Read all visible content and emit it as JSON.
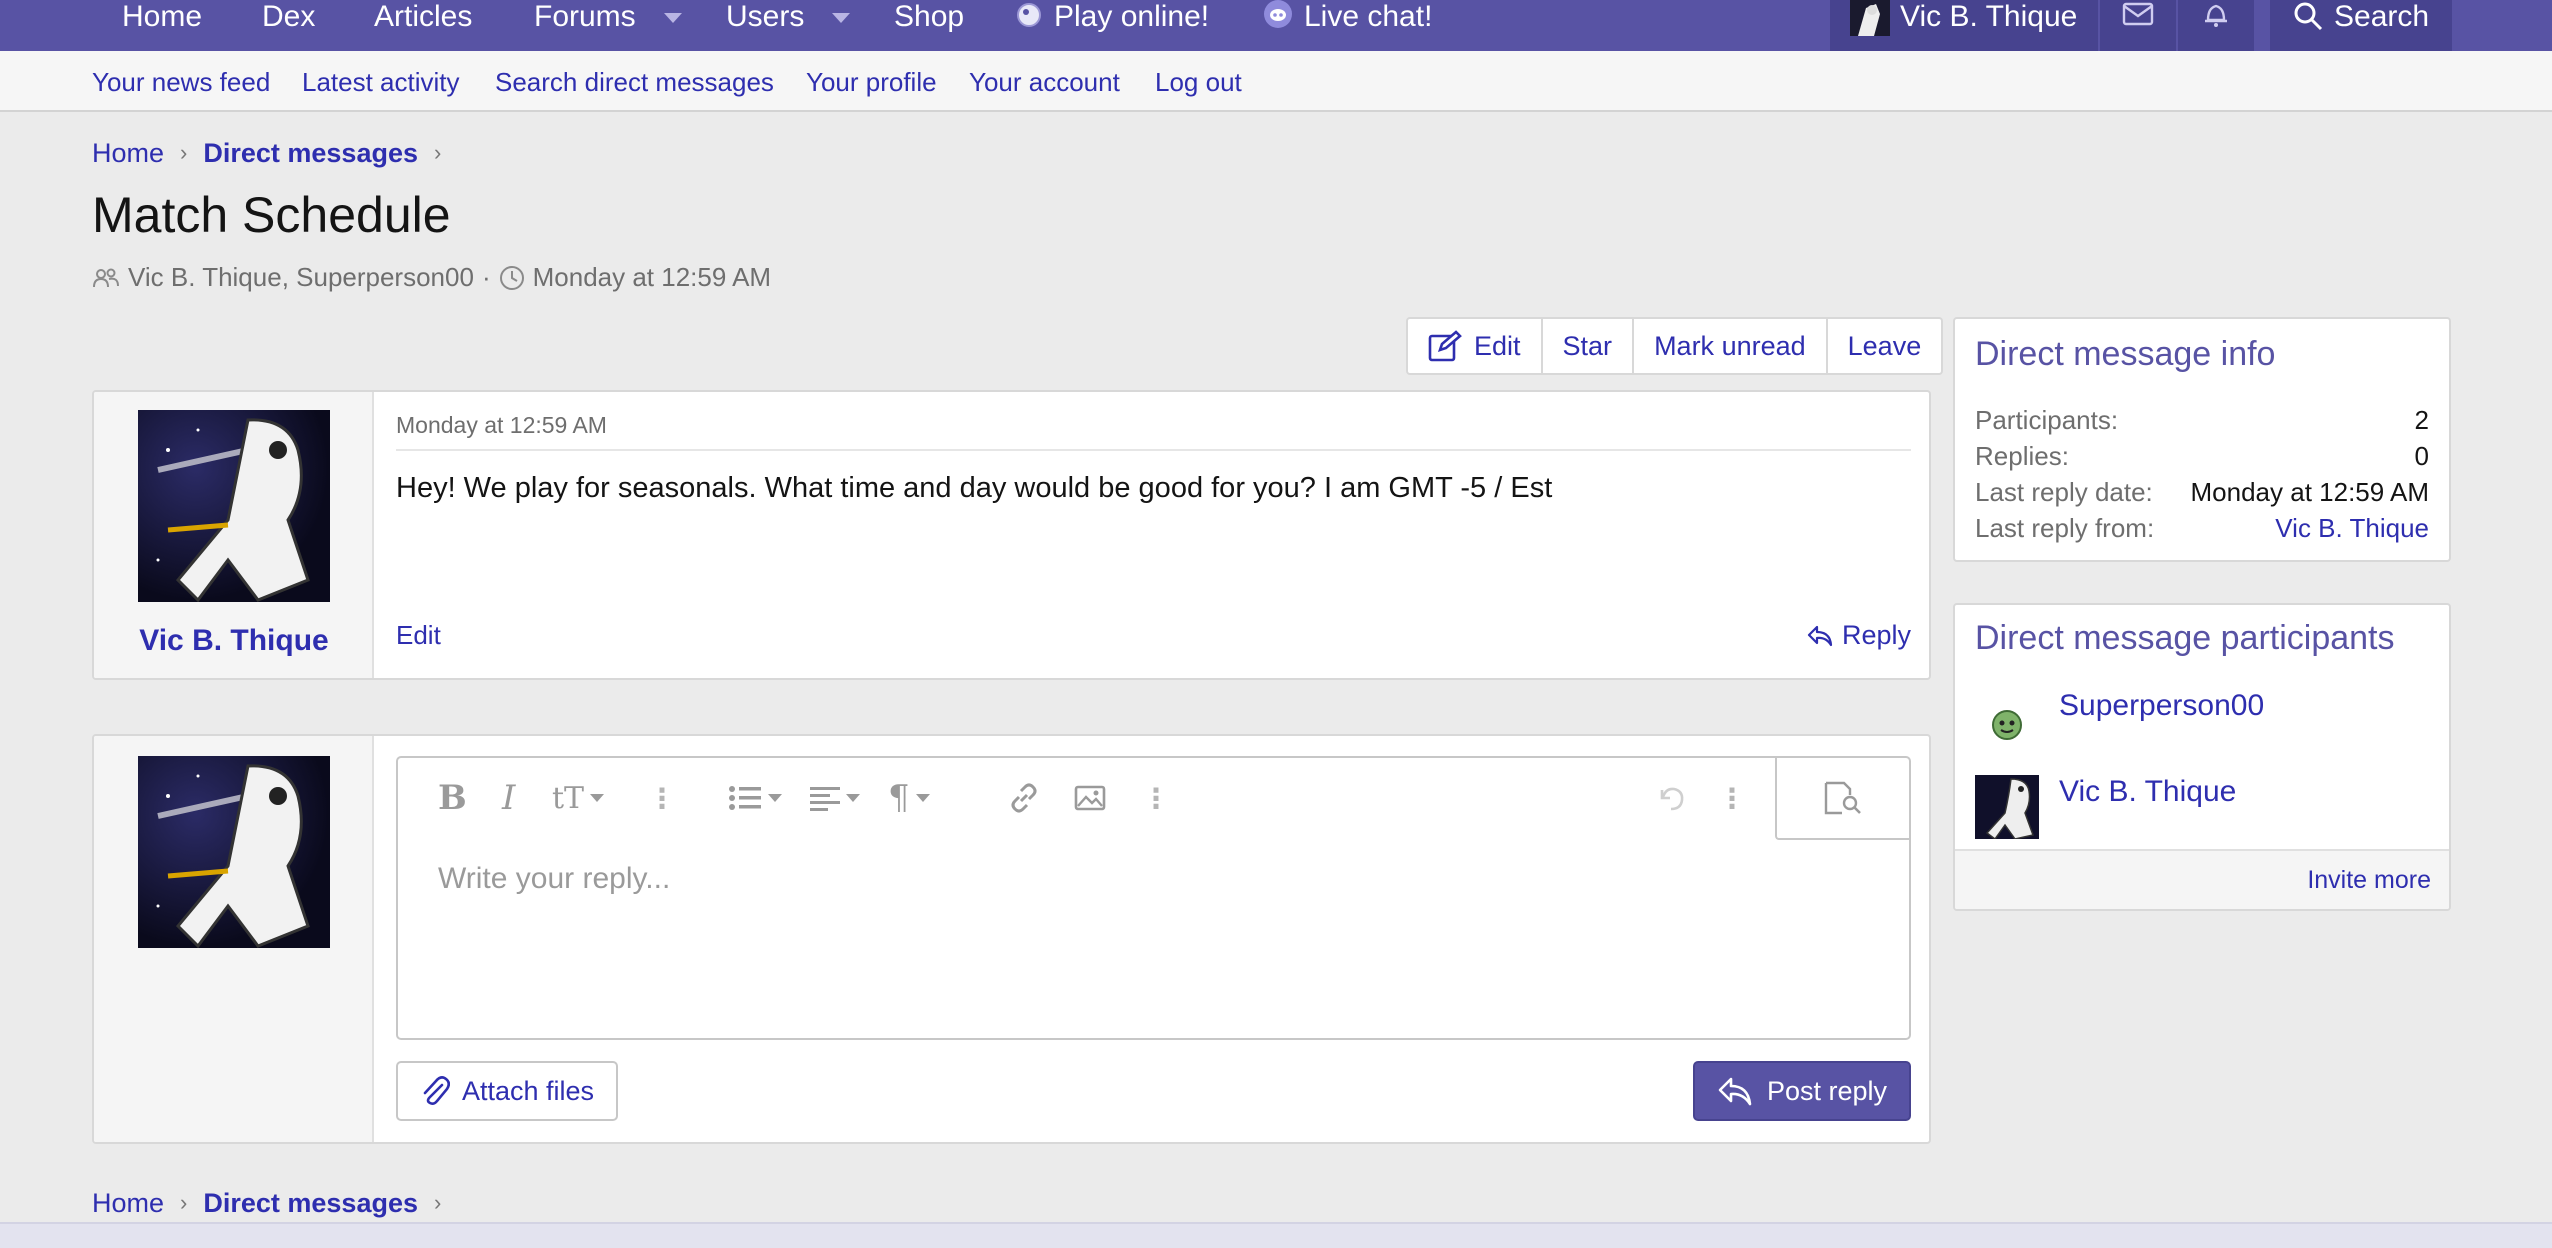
{
  "topnav": {
    "items": [
      {
        "label": "Home"
      },
      {
        "label": "Dex"
      },
      {
        "label": "Articles"
      },
      {
        "label": "Forums"
      },
      {
        "label": "Users"
      },
      {
        "label": "Shop"
      },
      {
        "label": "Play online!",
        "icon": "game-icon"
      },
      {
        "label": "Live chat!",
        "icon": "discord-icon"
      }
    ],
    "user_label": "Vic B. Thique",
    "search_label": "Search",
    "colors": {
      "bar": "#5853a4",
      "bar_dark": "#47438f"
    }
  },
  "subnav": {
    "links": [
      "Your news feed",
      "Latest activity",
      "Search direct messages",
      "Your profile",
      "Your account",
      "Log out"
    ]
  },
  "breadcrumb": {
    "home": "Home",
    "section": "Direct messages"
  },
  "page": {
    "title": "Match Schedule",
    "participants_line": "Vic B. Thique, Superperson00",
    "separator": "·",
    "date": "Monday at 12:59 AM"
  },
  "actions": {
    "edit": "Edit",
    "star": "Star",
    "mark_unread": "Mark unread",
    "leave": "Leave"
  },
  "message": {
    "author": "Vic B. Thique",
    "date": "Monday at 12:59 AM",
    "body": "Hey! We play for seasonals. What time and day would be good for you? I am GMT -5 / Est",
    "edit_label": "Edit",
    "reply_label": "Reply"
  },
  "editor": {
    "placeholder": "Write your reply...",
    "attach_label": "Attach files",
    "post_label": "Post reply",
    "toolbar_icons": [
      "bold-icon",
      "italic-icon",
      "text-size-icon",
      "more-icon",
      "list-icon",
      "align-icon",
      "paragraph-icon",
      "link-icon",
      "image-icon",
      "more-icon",
      "undo-icon",
      "more-icon",
      "preview-icon"
    ]
  },
  "info": {
    "title": "Direct message info",
    "rows": [
      {
        "label": "Participants:",
        "value": "2"
      },
      {
        "label": "Replies:",
        "value": "0"
      },
      {
        "label": "Last reply date:",
        "value": "Monday at 12:59 AM"
      },
      {
        "label": "Last reply from:",
        "value": "Vic B. Thique"
      }
    ]
  },
  "participants": {
    "title": "Direct message participants",
    "list": [
      {
        "name": "Superperson00"
      },
      {
        "name": "Vic B. Thique"
      }
    ],
    "invite_label": "Invite more"
  }
}
